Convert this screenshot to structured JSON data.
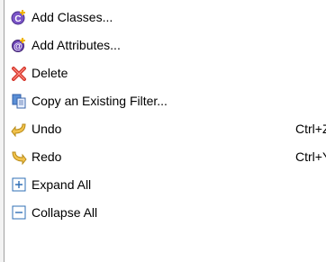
{
  "menu": {
    "items": [
      {
        "label": "Add Classes...",
        "icon": "add-classes-icon",
        "shortcut": ""
      },
      {
        "label": "Add Attributes...",
        "icon": "add-attributes-icon",
        "shortcut": ""
      },
      {
        "label": "Delete",
        "icon": "delete-icon",
        "shortcut": ""
      },
      {
        "label": "Copy an Existing Filter...",
        "icon": "copy-filter-icon",
        "shortcut": ""
      },
      {
        "label": "Undo",
        "icon": "undo-icon",
        "shortcut": "Ctrl+Z"
      },
      {
        "label": "Redo",
        "icon": "redo-icon",
        "shortcut": "Ctrl+Y"
      },
      {
        "label": "Expand All",
        "icon": "expand-all-icon",
        "shortcut": ""
      },
      {
        "label": "Collapse All",
        "icon": "collapse-all-icon",
        "shortcut": ""
      }
    ]
  },
  "colors": {
    "background": "#ffffff",
    "separator": "#a0a0a0",
    "text": "#000000",
    "class_icon": "#7b55c7",
    "add_badge": "#f0b400",
    "delete": "#d63a2f",
    "arrow": "#f2c24d",
    "tree_box": "#2f6fb6"
  }
}
